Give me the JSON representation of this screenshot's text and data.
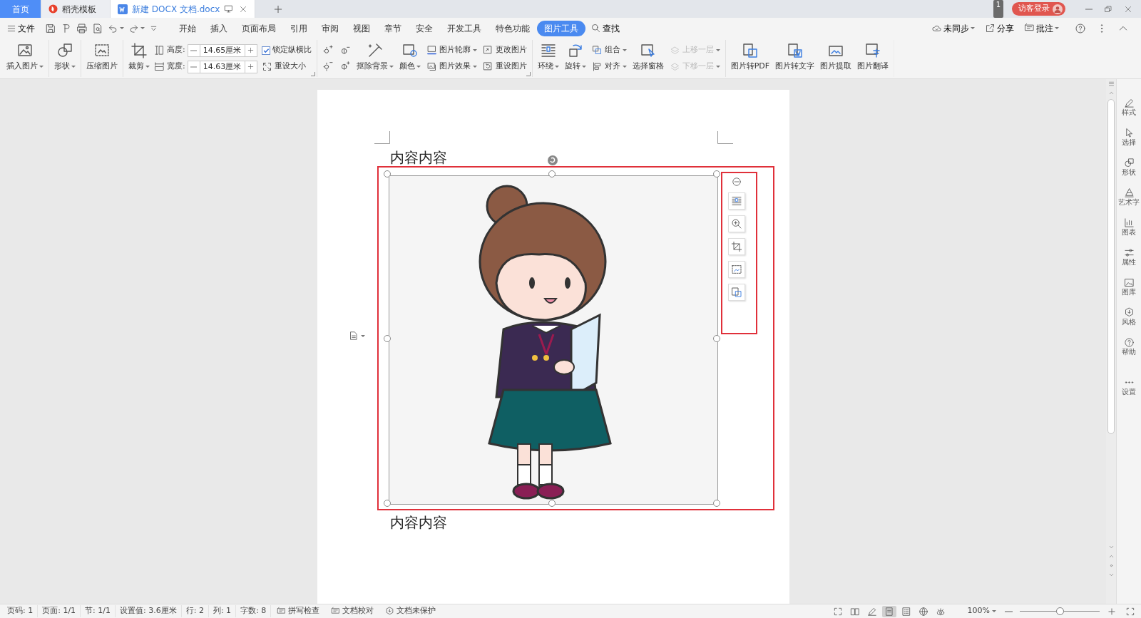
{
  "tabs": [
    {
      "label": "首页",
      "kind": "home",
      "selected": false
    },
    {
      "label": "稻壳模板",
      "kind": "docer",
      "selected": false
    },
    {
      "label": "新建 DOCX 文档.docx",
      "kind": "doc",
      "selected": true
    }
  ],
  "title_bar": {
    "badge": "1",
    "login": "访客登录"
  },
  "menu": {
    "file": "文件",
    "items": [
      {
        "label": "开始",
        "selected": false
      },
      {
        "label": "插入",
        "selected": false
      },
      {
        "label": "页面布局",
        "selected": false
      },
      {
        "label": "引用",
        "selected": false
      },
      {
        "label": "审阅",
        "selected": false
      },
      {
        "label": "视图",
        "selected": false
      },
      {
        "label": "章节",
        "selected": false
      },
      {
        "label": "安全",
        "selected": false
      },
      {
        "label": "开发工具",
        "selected": false
      },
      {
        "label": "特色功能",
        "selected": false
      },
      {
        "label": "图片工具",
        "selected": true
      }
    ],
    "search": "查找",
    "right": [
      {
        "label": "未同步",
        "dropdown": true
      },
      {
        "label": "分享",
        "dropdown": false
      },
      {
        "label": "批注",
        "dropdown": true
      }
    ]
  },
  "ribbon": [
    {
      "launcher": false,
      "items": [
        {
          "kind": "big",
          "label": "插入图片",
          "dropdown": true
        }
      ]
    },
    {
      "launcher": false,
      "items": [
        {
          "kind": "big",
          "label": "形状",
          "dropdown": true
        }
      ]
    },
    {
      "launcher": false,
      "items": [
        {
          "kind": "big",
          "label": "压缩图片",
          "dropdown": false
        }
      ]
    },
    {
      "launcher": true,
      "items": [
        {
          "kind": "big",
          "label": "裁剪",
          "dropdown": true
        },
        {
          "kind": "size",
          "label": "高度:",
          "value": "14.65厘米"
        },
        {
          "kind": "size",
          "label": "宽度:",
          "value": "14.63厘米"
        },
        {
          "kind": "check",
          "label": "锁定纵横比",
          "checked": true
        },
        {
          "kind": "small",
          "label": "重设大小",
          "dropdown": false,
          "disabled": false
        }
      ]
    },
    {
      "launcher": true,
      "items": [
        {
          "kind": "icon"
        },
        {
          "kind": "icon"
        },
        {
          "kind": "icon"
        },
        {
          "kind": "icon"
        },
        {
          "kind": "big",
          "label": "抠除背景",
          "dropdown": true
        },
        {
          "kind": "big",
          "label": "颜色",
          "dropdown": true
        },
        {
          "kind": "small",
          "label": "图片轮廓",
          "dropdown": true,
          "disabled": false
        },
        {
          "kind": "small",
          "label": "图片效果",
          "dropdown": true,
          "disabled": false
        },
        {
          "kind": "small",
          "label": "更改图片",
          "dropdown": false,
          "disabled": false
        },
        {
          "kind": "small",
          "label": "重设图片",
          "dropdown": false,
          "disabled": false
        }
      ]
    },
    {
      "launcher": false,
      "items": [
        {
          "kind": "big",
          "label": "环绕",
          "dropdown": true
        },
        {
          "kind": "big",
          "label": "旋转",
          "dropdown": true
        },
        {
          "kind": "small",
          "label": "组合",
          "dropdown": true,
          "disabled": false
        },
        {
          "kind": "small",
          "label": "对齐",
          "dropdown": true,
          "disabled": false
        },
        {
          "kind": "big",
          "label": "选择窗格",
          "dropdown": false
        },
        {
          "kind": "small",
          "label": "上移一层",
          "dropdown": true,
          "disabled": true
        },
        {
          "kind": "small",
          "label": "下移一层",
          "dropdown": true,
          "disabled": true
        }
      ]
    },
    {
      "launcher": false,
      "items": [
        {
          "kind": "big",
          "label": "图片转PDF",
          "dropdown": false
        },
        {
          "kind": "big",
          "label": "图片转文字",
          "dropdown": false
        },
        {
          "kind": "big",
          "label": "图片提取",
          "dropdown": false
        },
        {
          "kind": "big",
          "label": "图片翻译",
          "dropdown": false
        }
      ]
    }
  ],
  "document": {
    "paragraphs": [
      "内容内容",
      "内容内容"
    ]
  },
  "sidebar": [
    "样式",
    "选择",
    "形状",
    "艺术字",
    "图表",
    "属性",
    "图库",
    "风格",
    "帮助",
    "设置"
  ],
  "status_bar": {
    "items": [
      "页码: 1",
      "页面: 1/1",
      "节: 1/1",
      "设置值: 3.6厘米",
      "行: 2",
      "列: 1",
      "字数: 8"
    ],
    "tools": [
      "拼写检查",
      "文档校对",
      "文档未保护"
    ],
    "views": [
      {
        "selected": false
      },
      {
        "selected": false
      },
      {
        "selected": false
      },
      {
        "selected": true
      },
      {
        "selected": false
      },
      {
        "selected": false
      },
      {
        "selected": false
      }
    ],
    "zoom": {
      "text": "100%",
      "level": 0.5
    }
  }
}
